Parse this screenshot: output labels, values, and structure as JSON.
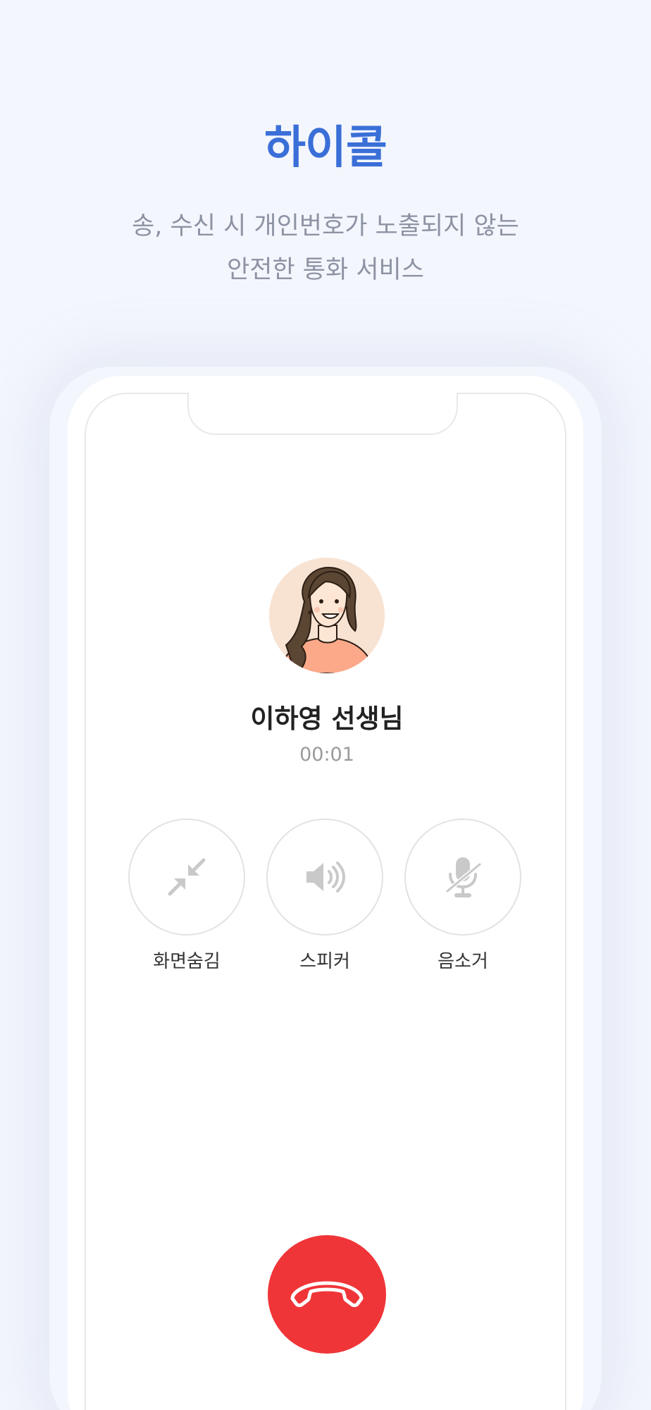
{
  "header": {
    "title": "하이콜",
    "subtitle_line1": "송, 수신 시 개인번호가 노출되지 않는",
    "subtitle_line2": "안전한 통화 서비스"
  },
  "call": {
    "caller_name": "이하영 선생님",
    "timer": "00:01"
  },
  "controls": [
    {
      "label": "화면숨김",
      "icon": "minimize-icon"
    },
    {
      "label": "스피커",
      "icon": "speaker-icon"
    },
    {
      "label": "음소거",
      "icon": "mute-icon"
    }
  ],
  "end_call": {
    "icon": "hang-up-icon"
  },
  "colors": {
    "accent": "#3a6fd8",
    "end_call": "#f03538",
    "background": "#f3f6fd",
    "icon_gray": "#c9c9c9"
  }
}
